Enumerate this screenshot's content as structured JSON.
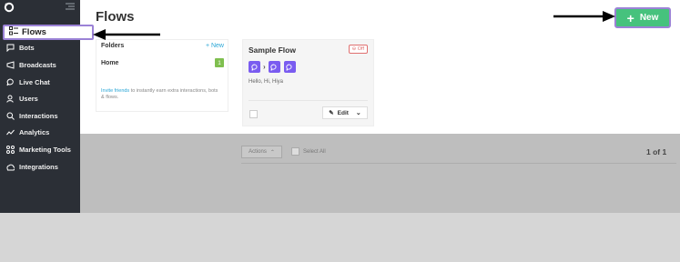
{
  "sidebar": {
    "active": {
      "label": "Flows",
      "icon": "flows-icon"
    },
    "items": [
      {
        "label": "Bots",
        "icon": "bots-icon"
      },
      {
        "label": "Broadcasts",
        "icon": "broadcasts-icon"
      },
      {
        "label": "Live Chat",
        "icon": "live-chat-icon"
      },
      {
        "label": "Users",
        "icon": "users-icon"
      },
      {
        "label": "Interactions",
        "icon": "search-icon"
      },
      {
        "label": "Analytics",
        "icon": "analytics-icon"
      },
      {
        "label": "Marketing Tools",
        "icon": "marketing-tools-icon"
      },
      {
        "label": "Integrations",
        "icon": "integrations-icon"
      }
    ]
  },
  "header": {
    "title": "Flows",
    "new_button": "New"
  },
  "folders": {
    "heading": "Folders",
    "new_link": "+ New",
    "items": [
      {
        "label": "Home",
        "count": "1"
      }
    ],
    "invite_link": "Invite friends",
    "invite_text": " to instantly earn extra interactions, bots & flows."
  },
  "flow_card": {
    "title": "Sample Flow",
    "status": "Off",
    "subtitle": "Hello, Hi, Hiya",
    "edit_label": "Edit"
  },
  "list_controls": {
    "actions_label": "Actions",
    "select_all_label": "Select All",
    "pagination": "1 of 1"
  },
  "colors": {
    "sidebar_bg": "#2b2f36",
    "accent_green": "#46c27d",
    "highlight_purple": "#9b82d6",
    "node_purple": "#7a5cf0",
    "link_blue": "#2aa6d6"
  }
}
